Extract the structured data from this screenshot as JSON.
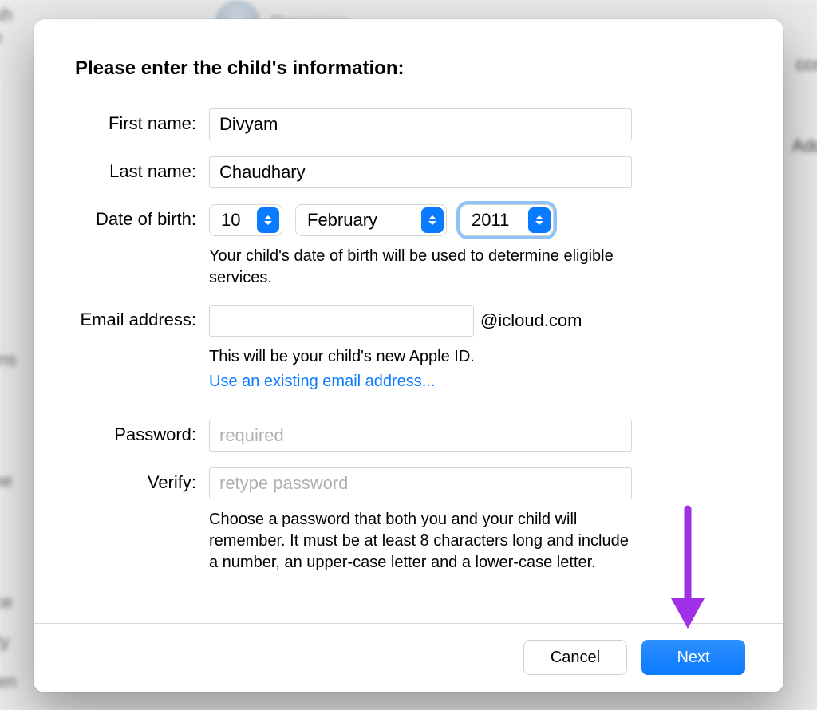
{
  "background": {
    "organiser_label": "Organiser",
    "sidebar": [
      "ush",
      "ID",
      "n",
      "ions",
      "ime",
      "nce",
      "ility",
      "Cen"
    ],
    "right_labels": [
      "ccou",
      "Add I"
    ]
  },
  "dialog": {
    "title": "Please enter the child's information:",
    "fields": {
      "first_name": {
        "label": "First name:",
        "value": "Divyam"
      },
      "last_name": {
        "label": "Last name:",
        "value": "Chaudhary"
      },
      "dob": {
        "label": "Date of birth:",
        "day": "10",
        "month": "February",
        "year": "2011",
        "hint": "Your child's date of birth will be used to determine eligible services."
      },
      "email": {
        "label": "Email address:",
        "value": "",
        "suffix": "@icloud.com",
        "hint": "This will be your child's new Apple ID.",
        "link": "Use an existing email address..."
      },
      "password": {
        "label": "Password:",
        "placeholder": "required"
      },
      "verify": {
        "label": "Verify:",
        "placeholder": "retype password",
        "hint": "Choose a password that both you and your child will remember. It must be at least 8 characters long and include a number, an upper-case letter and a lower-case letter."
      }
    },
    "buttons": {
      "cancel": "Cancel",
      "next": "Next"
    }
  },
  "annotation": {
    "arrow_color": "#a030e8"
  }
}
